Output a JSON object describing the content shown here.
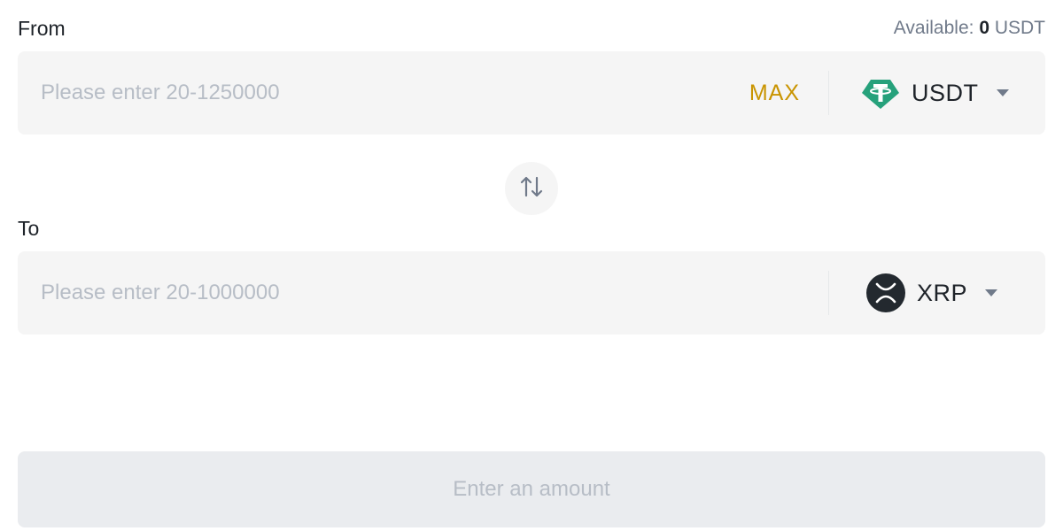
{
  "from": {
    "label": "From",
    "available_label": "Available: ",
    "available_amount": "0",
    "available_unit": " USDT",
    "placeholder": "Please enter 20-1250000",
    "max_label": "MAX",
    "coin": {
      "symbol": "USDT",
      "icon": "tether-icon",
      "color": "#26a17b"
    }
  },
  "swap": {
    "icon": "swap-arrows-icon"
  },
  "to": {
    "label": "To",
    "placeholder": "Please enter 20-1000000",
    "coin": {
      "symbol": "XRP",
      "icon": "xrp-icon",
      "color": "#23292f"
    }
  },
  "submit": {
    "label": "Enter an amount"
  },
  "colors": {
    "accent": "#c99400",
    "field_bg": "#f5f5f5",
    "button_disabled_bg": "#eaecef",
    "placeholder": "#b7bdc6"
  }
}
